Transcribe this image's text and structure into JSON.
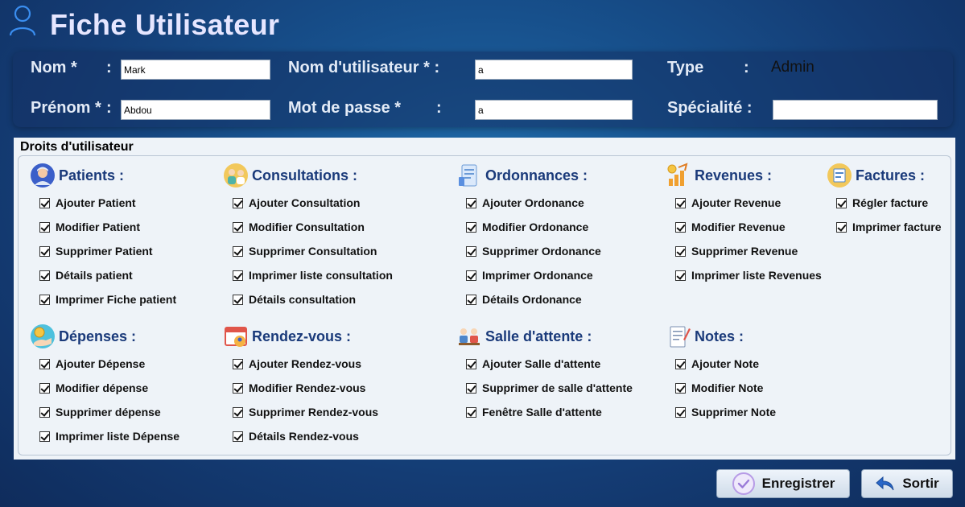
{
  "header": {
    "title": "Fiche Utilisateur",
    "icon": "user-icon"
  },
  "form": {
    "nom_label": "Nom *",
    "nom_value": "Mark",
    "prenom_label": "Prénom *",
    "prenom_value": "Abdou",
    "username_label": "Nom d'utilisateur * :",
    "username_value": "a",
    "password_label": "Mot de passe *",
    "password_value": "a",
    "type_label": "Type",
    "type_value": "Admin",
    "specialite_label": "Spécialité :",
    "specialite_value": "",
    "colon": ":"
  },
  "rights": {
    "title": "Droits d'utilisateur",
    "groups": [
      {
        "title": "Patients :",
        "icon": "patient-icon",
        "items": [
          "Ajouter Patient",
          "Modifier Patient",
          "Supprimer Patient",
          "Détails patient",
          "Imprimer Fiche patient"
        ]
      },
      {
        "title": "Consultations :",
        "icon": "consultation-icon",
        "items": [
          "Ajouter Consultation",
          "Modifier Consultation",
          "Supprimer Consultation",
          "Imprimer liste consultation",
          "Détails consultation"
        ]
      },
      {
        "title": "Ordonnances :",
        "icon": "prescription-icon",
        "items": [
          "Ajouter Ordonance",
          "Modifier Ordonance",
          "Supprimer Ordonance",
          "Imprimer Ordonance",
          "Détails Ordonance"
        ]
      },
      {
        "title": "Revenues :",
        "icon": "revenue-icon",
        "items": [
          "Ajouter Revenue",
          "Modifier Revenue",
          "Supprimer Revenue",
          "Imprimer liste Revenues"
        ]
      },
      {
        "title": "Factures :",
        "icon": "invoice-icon",
        "items": [
          "Régler facture",
          "Imprimer facture"
        ]
      },
      {
        "title": "Dépenses :",
        "icon": "expense-icon",
        "items": [
          "Ajouter Dépense",
          "Modifier dépense",
          "Supprimer dépense",
          "Imprimer liste Dépense"
        ]
      },
      {
        "title": "Rendez-vous :",
        "icon": "calendar-icon",
        "items": [
          "Ajouter Rendez-vous",
          "Modifier Rendez-vous",
          "Supprimer Rendez-vous",
          "Détails Rendez-vous"
        ]
      },
      {
        "title": "Salle d'attente :",
        "icon": "waiting-room-icon",
        "items": [
          "Ajouter Salle d'attente",
          "Supprimer de salle d'attente",
          "Fenêtre Salle d'attente"
        ]
      },
      {
        "title": "Notes :",
        "icon": "notes-icon",
        "items": [
          "Ajouter Note",
          "Modifier Note",
          "Supprimer Note"
        ]
      }
    ]
  },
  "buttons": {
    "save_label": "Enregistrer",
    "save_icon": "check-circle-icon",
    "exit_label": "Sortir",
    "exit_icon": "back-arrow-icon"
  }
}
